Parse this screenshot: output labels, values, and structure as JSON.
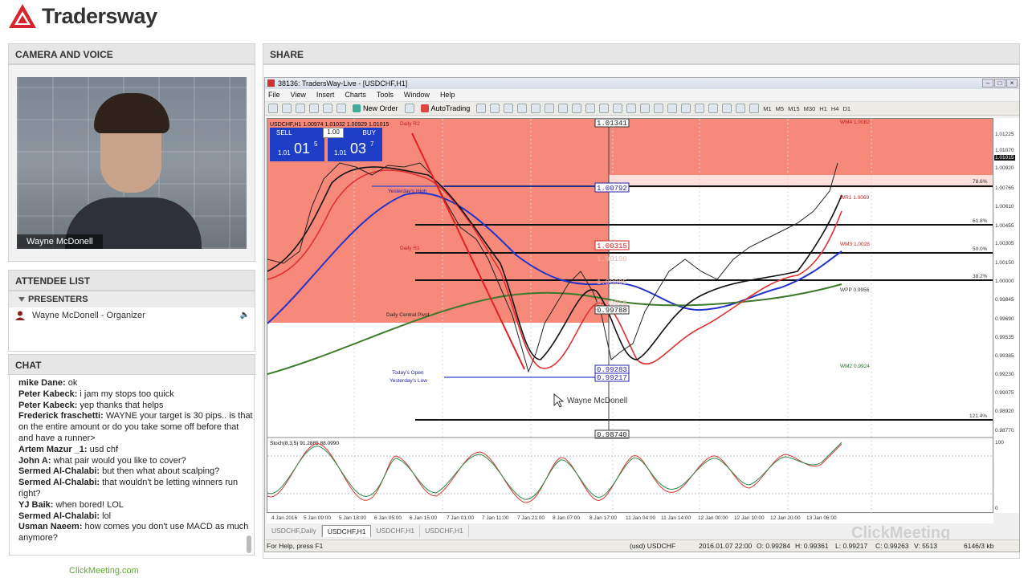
{
  "brand": {
    "logo_text": "Tradersway",
    "footer_link": "ClickMeeting.com"
  },
  "camera": {
    "section_title": "CAMERA AND VOICE",
    "presenter_label": "Wayne McDonell"
  },
  "attendees": {
    "section_title": "ATTENDEE LIST",
    "group_label": "PRESENTERS",
    "members": [
      {
        "name": "Wayne McDonell - Organizer"
      }
    ]
  },
  "chat": {
    "section_title": "CHAT",
    "messages": [
      {
        "name": "mike Dane:",
        "text": " ok"
      },
      {
        "name": "Peter Kabeck:",
        "text": " i jam my stops too quick"
      },
      {
        "name": "Peter Kabeck:",
        "text": " yep thanks that helps"
      },
      {
        "name": "Frederick fraschetti:",
        "text": " WAYNE your target is 30 pips.. is that on the entire amount or do you take some off before that and have a runner>"
      },
      {
        "name": "Artem Mazur _1:",
        "text": " usd chf"
      },
      {
        "name": "John A:",
        "text": " what pair would you like to cover?"
      },
      {
        "name": "Sermed Al-Chalabi:",
        "text": " but then what about scalping?"
      },
      {
        "name": "Sermed Al-Chalabi:",
        "text": " that wouldn't be letting winners run right?"
      },
      {
        "name": "YJ Baik:",
        "text": " when bored!  LOL"
      },
      {
        "name": "Sermed Al-Chalabi:",
        "text": " lol"
      },
      {
        "name": "Usman Naeem:",
        "text": " how comes you don't use MACD as much anymore?"
      }
    ]
  },
  "share": {
    "section_title": "SHARE",
    "window_title": "38136: TradersWay-Live - [USDCHF,H1]",
    "menu": [
      "File",
      "View",
      "Insert",
      "Charts",
      "Tools",
      "Window",
      "Help"
    ],
    "toolbar": {
      "new_order": "New Order",
      "autotrading": "AutoTrading",
      "timeframes": [
        "M1",
        "M5",
        "M15",
        "M30",
        "H1",
        "H4",
        "D1"
      ]
    },
    "trade_panel": {
      "sell_label": "SELL",
      "buy_label": "BUY",
      "lot": "1.00",
      "sell_prefix": "1.01",
      "sell_big": "01",
      "sell_sup": "5",
      "buy_prefix": "1.01",
      "buy_big": "03",
      "buy_sup": "7"
    },
    "chart_header": "USDCHF,H1  1.00974 1.01032 1.00929 1.01015",
    "stoch_header": "Stoch(8,3,5) 91.2885 88.0990",
    "annotations": {
      "daily_r2": "Daily R2",
      "yesterday_high": "Yesterday's High",
      "daily_r1": "Daily R1",
      "central_pivot": "Daily Central Pivot",
      "todays_open": "Today's Open",
      "yesterday_low": "Yesterday's Low",
      "wm4": "WM4 1.0082",
      "wr1": "WR1 1.0069",
      "wm3": "WM3 1.0028",
      "wpp": "WPP 0.9956",
      "wm2": "WM2 0.9924",
      "fib786": "78.6%",
      "fib618": "61.8%",
      "fib500": "50.0%",
      "fib382": "38.2%",
      "fib1214": "121.4%",
      "pointer_name": "Wayne McDonell"
    },
    "price_boxes": [
      "1.01341",
      "1.00792",
      "1.00315",
      "1.00190",
      "1.00005",
      "0.99815",
      "0.99788",
      "0.99283",
      "0.99217",
      "0.98740"
    ],
    "price_axis": [
      "1.01225",
      "1.01070",
      "1.01015",
      "1.00920",
      "1.00765",
      "1.00610",
      "1.00455",
      "1.00305",
      "1.00150",
      "1.00000",
      "0.99845",
      "0.99690",
      "0.99535",
      "0.99385",
      "0.99230",
      "0.99075",
      "0.98920",
      "0.98770"
    ],
    "stoch_axis": [
      "100",
      "0"
    ],
    "time_axis": [
      "4 Jan 2016",
      "5 Jan 09:00",
      "5 Jan 18:00",
      "6 Jan 05:00",
      "6 Jan 15:00",
      "7 Jan 01:00",
      "7 Jan 11:00",
      "7 Jan 21:00",
      "8 Jan 07:00",
      "8 Jan 17:00",
      "11 Jan 04:00",
      "11 Jan 14:00",
      "12 Jan 00:00",
      "12 Jan 10:00",
      "12 Jan 20:00",
      "13 Jan 06:00"
    ],
    "tabs": [
      "USDCHF,Daily",
      "USDCHF,H1",
      "USDCHF,H1",
      "USDCHF,H1"
    ],
    "status": {
      "help": "For Help, press F1",
      "symbol": "(usd) USDCHF",
      "datetime": "2016.01.07 22:00",
      "open": "O: 0.99284",
      "high": "H: 0.99361",
      "low": "L: 0.99217",
      "close": "C: 0.99263",
      "volume": "V: 5513",
      "traffic": "6146/3 kb"
    },
    "watermark": "ClickMeeting"
  }
}
